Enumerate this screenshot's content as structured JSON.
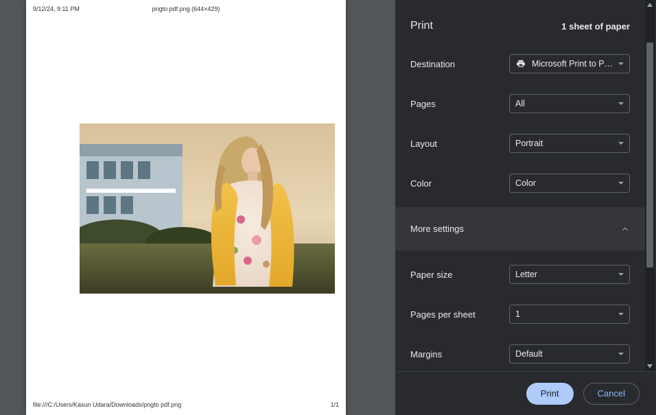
{
  "header": {
    "title": "Print",
    "sheet_info": "1 sheet of paper"
  },
  "preview": {
    "datetime": "9/12/24, 9:11 PM",
    "filename_dims": "pngto pdf.png (644×429)",
    "footer_path": "file:///C:/Users/Kasun Udara/Downloads/pngto pdf.png",
    "footer_page": "1/1"
  },
  "settings": {
    "destination": {
      "label": "Destination",
      "value": "Microsoft Print to PDF"
    },
    "pages": {
      "label": "Pages",
      "value": "All"
    },
    "layout": {
      "label": "Layout",
      "value": "Portrait"
    },
    "color": {
      "label": "Color",
      "value": "Color"
    },
    "more_settings_label": "More settings",
    "paper_size": {
      "label": "Paper size",
      "value": "Letter"
    },
    "pages_per_sheet": {
      "label": "Pages per sheet",
      "value": "1"
    },
    "margins": {
      "label": "Margins",
      "value": "Default"
    }
  },
  "buttons": {
    "print": "Print",
    "cancel": "Cancel"
  }
}
